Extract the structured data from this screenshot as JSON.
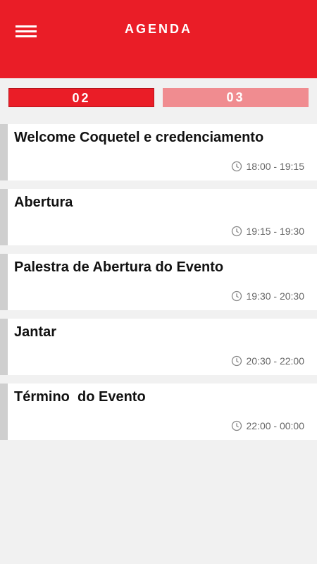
{
  "header": {
    "title": "AGENDA",
    "menu_icon": "hamburger-icon",
    "background": "#ea1d27"
  },
  "tabs": [
    {
      "label": "02",
      "active": true,
      "color": "#ea1d27"
    },
    {
      "label": "03",
      "active": false,
      "color": "#f08c90"
    }
  ],
  "events": [
    {
      "title": "Welcome Coquetel e credenciamento",
      "time": "18:00 - 19:15"
    },
    {
      "title": "Abertura",
      "time": "19:15 - 19:30"
    },
    {
      "title": "Palestra de Abertura do Evento",
      "time": "19:30 - 20:30"
    },
    {
      "title": "Jantar",
      "time": "20:30 - 22:00"
    },
    {
      "title": "Término  do Evento",
      "time": "22:00 - 00:00"
    }
  ]
}
